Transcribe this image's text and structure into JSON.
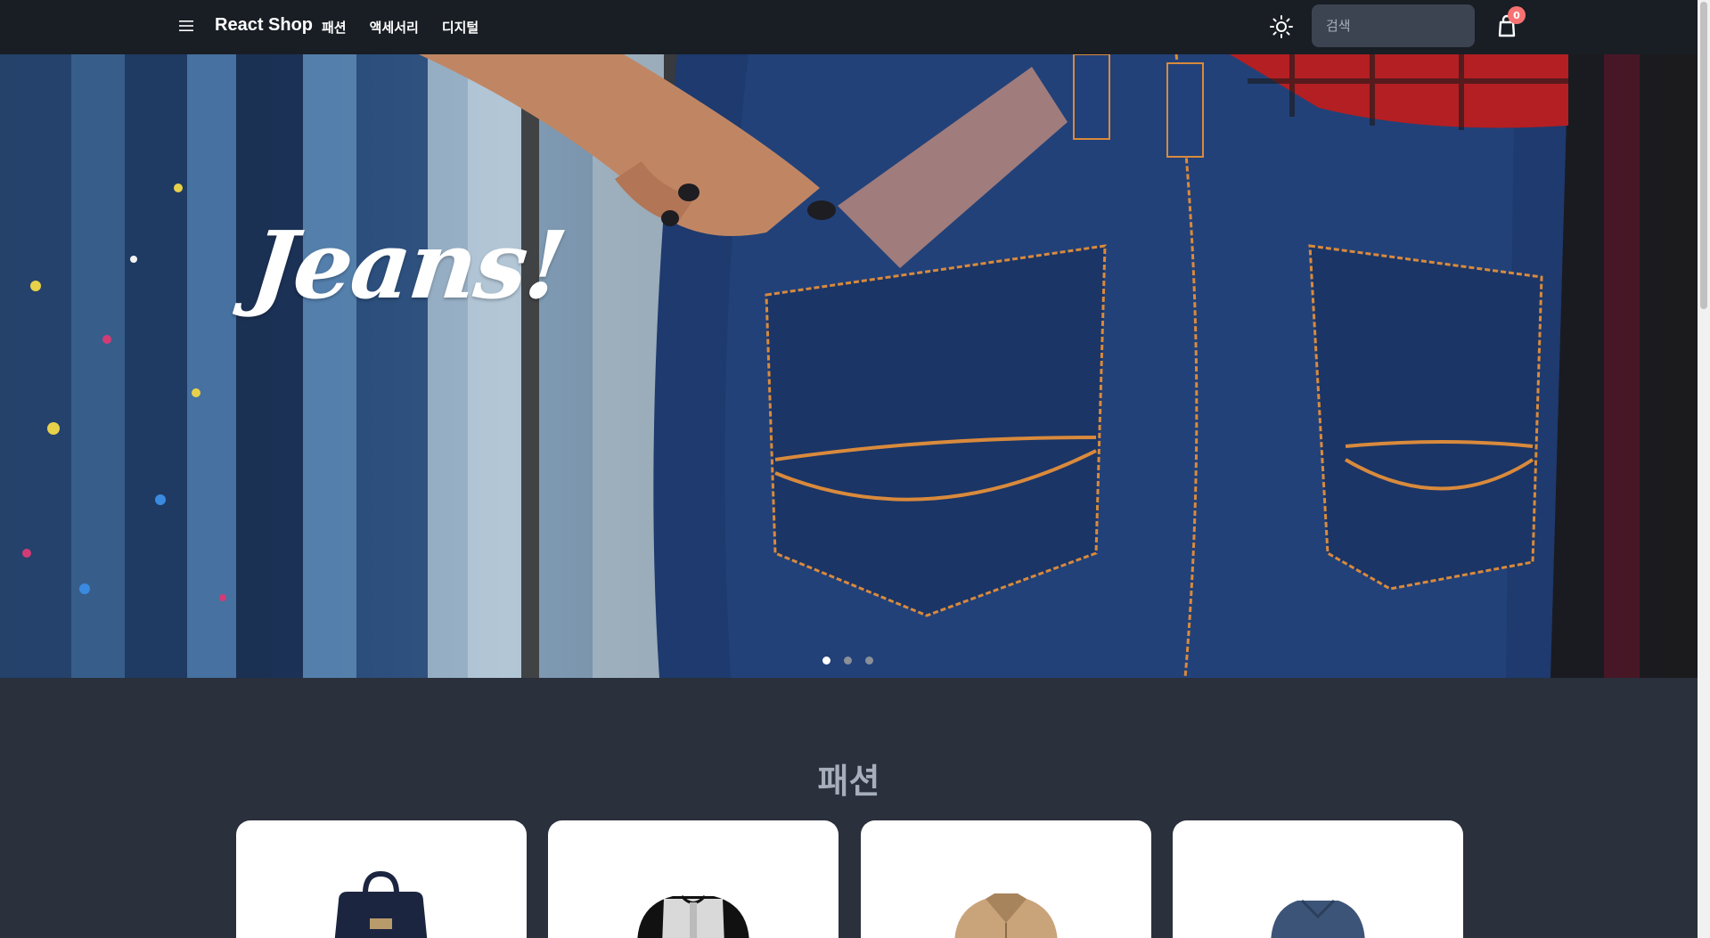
{
  "navbar": {
    "brand": "React Shop",
    "links": [
      "패션",
      "액세서리",
      "디지털"
    ],
    "search_placeholder": "검색",
    "cart_count": "0"
  },
  "hero": {
    "title": "Jeans!",
    "slides": 3,
    "active_slide": 1
  },
  "section": {
    "title": "패션"
  },
  "products": [
    {
      "icon": "bag-product-image"
    },
    {
      "icon": "henley-shirt-product-image"
    },
    {
      "icon": "jacket-product-image"
    },
    {
      "icon": "sweater-product-image"
    }
  ],
  "colors": {
    "navbar_bg": "#191d24",
    "page_bg": "#2a303c",
    "input_bg": "#3d4451",
    "badge": "#f87272"
  }
}
